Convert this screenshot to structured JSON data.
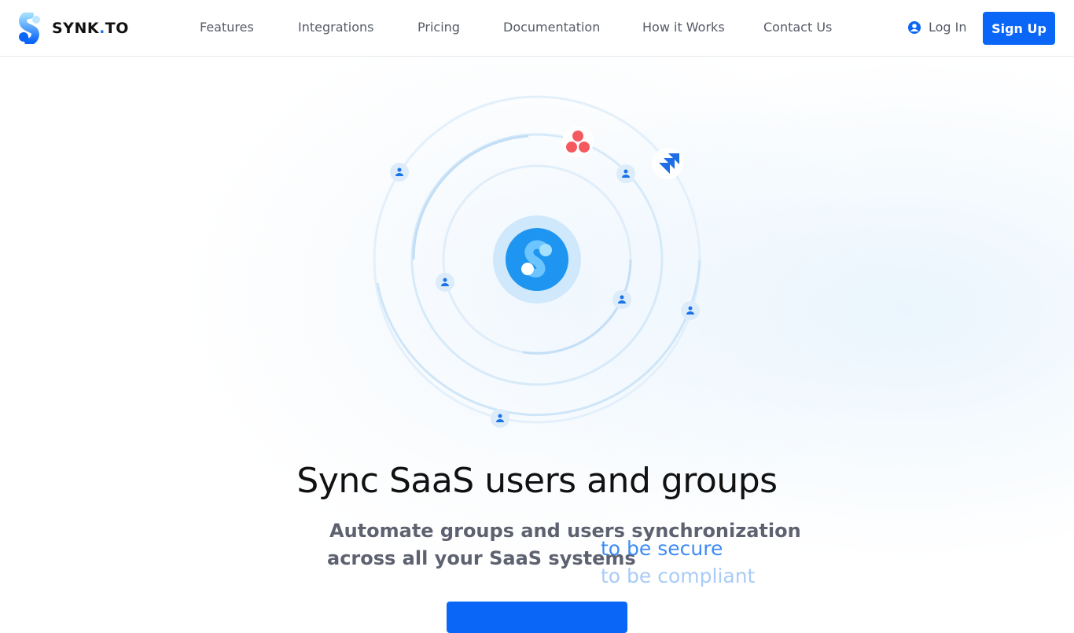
{
  "header": {
    "brand": "SYNK",
    "brand_dot": ".",
    "brand_suffix": "TO",
    "nav": [
      "Features",
      "Integrations",
      "Pricing",
      "Documentation",
      "How it Works",
      "Contact Us"
    ],
    "login": "Log In",
    "signup": "Sign Up"
  },
  "hero": {
    "title": "Sync SaaS users and groups",
    "subtitle_line1": "Automate groups and users synchronization",
    "subtitle_line2": "across all your SaaS systems",
    "rotating": [
      "to be secure",
      "to be compliant"
    ]
  },
  "colors": {
    "accent": "#0a66f7"
  }
}
